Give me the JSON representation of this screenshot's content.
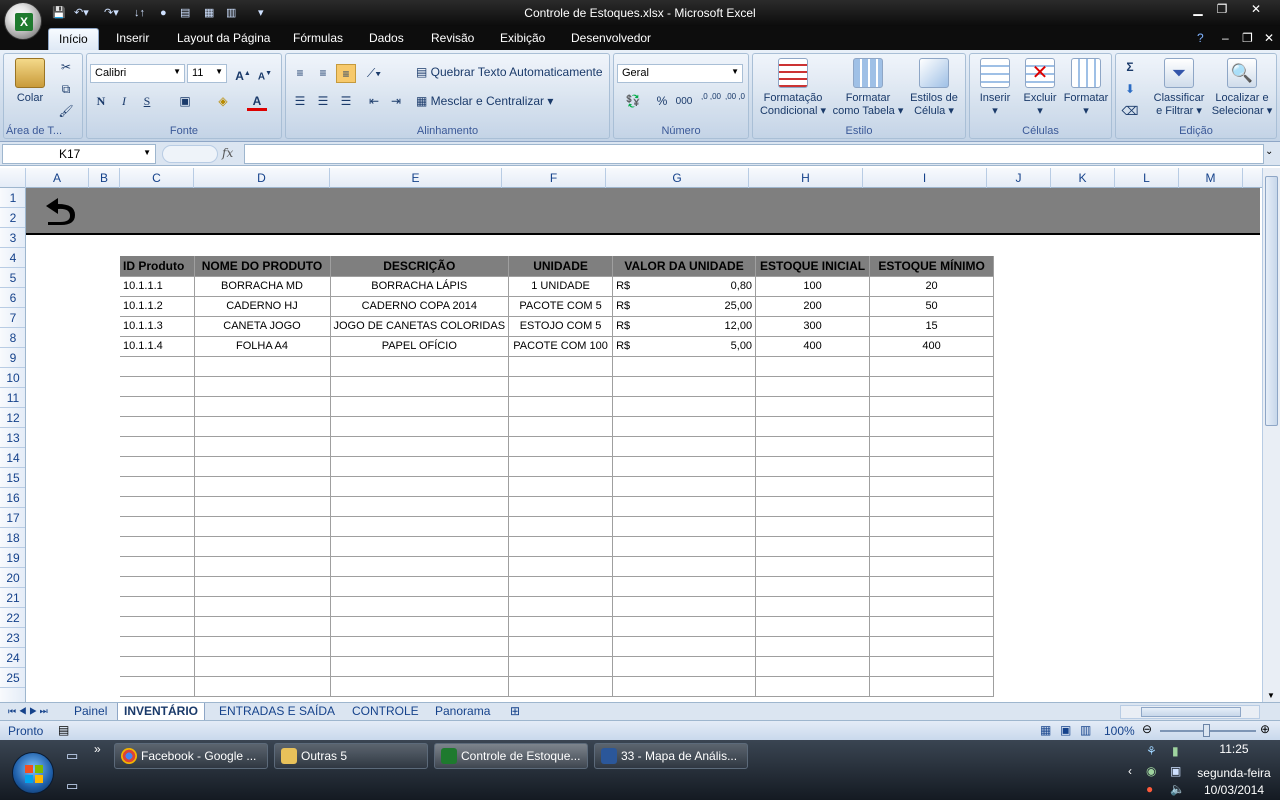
{
  "window": {
    "title": "Controle de Estoques.xlsx - Microsoft Excel"
  },
  "ribbon": {
    "tabs": [
      "Início",
      "Inserir",
      "Layout da Página",
      "Fórmulas",
      "Dados",
      "Revisão",
      "Exibição",
      "Desenvolvedor"
    ],
    "active_tab": "Início",
    "groups": {
      "clipboard": {
        "label": "Área de T...",
        "paste": "Colar"
      },
      "font": {
        "label": "Fonte",
        "font_name": "Calibri",
        "font_size": "11",
        "bold": "N",
        "italic": "I",
        "underline": "S"
      },
      "alignment": {
        "label": "Alinhamento",
        "wrap_text": "Quebrar Texto Automaticamente",
        "merge_center": "Mesclar e Centralizar"
      },
      "number": {
        "label": "Número",
        "format": "Geral",
        "percent": "%",
        "thousands": "000",
        "inc_decimal": ",0 ,00",
        "dec_decimal": ",00 ,0"
      },
      "style": {
        "label": "Estilo",
        "conditional": [
          "Formatação",
          "Condicional"
        ],
        "as_table": [
          "Formatar",
          "como Tabela"
        ],
        "cell_styles": [
          "Estilos de",
          "Célula"
        ]
      },
      "cells": {
        "label": "Células",
        "insert": "Inserir",
        "delete": "Excluir",
        "format": "Formatar"
      },
      "editing": {
        "label": "Edição",
        "sort_filter": [
          "Classificar",
          "e Filtrar"
        ],
        "find_select": [
          "Localizar e",
          "Selecionar"
        ],
        "sum": "Σ"
      }
    }
  },
  "formula_bar": {
    "name_box": "K17",
    "fx": "fx",
    "content": ""
  },
  "columns": [
    "A",
    "B",
    "C",
    "D",
    "E",
    "F",
    "G",
    "H",
    "I",
    "J",
    "K",
    "L",
    "M"
  ],
  "rows": [
    "1",
    "2",
    "3",
    "4",
    "5",
    "6",
    "7",
    "8",
    "9",
    "10",
    "11",
    "12",
    "13",
    "14",
    "15",
    "16",
    "17",
    "18",
    "19",
    "20",
    "21",
    "22",
    "23",
    "24",
    "25"
  ],
  "table": {
    "headers": [
      "ID Produto",
      "NOME DO PRODUTO",
      "DESCRIÇÃO",
      "UNIDADE",
      "VALOR DA UNIDADE",
      "ESTOQUE INICIAL",
      "ESTOQUE MÍNIMO"
    ],
    "rows": [
      {
        "id": "10.1.1.1",
        "nome": "BORRACHA MD",
        "descricao": "BORRACHA LÁPIS",
        "unidade": "1 UNIDADE",
        "moeda": "R$",
        "valor": "0,80",
        "inicial": "100",
        "minimo": "20"
      },
      {
        "id": "10.1.1.2",
        "nome": "CADERNO HJ",
        "descricao": "CADERNO COPA 2014",
        "unidade": "PACOTE COM 5",
        "moeda": "R$",
        "valor": "25,00",
        "inicial": "200",
        "minimo": "50"
      },
      {
        "id": "10.1.1.3",
        "nome": "CANETA JOGO",
        "descricao": "JOGO DE CANETAS COLORIDAS",
        "unidade": "ESTOJO COM 5",
        "moeda": "R$",
        "valor": "12,00",
        "inicial": "300",
        "minimo": "15"
      },
      {
        "id": "10.1.1.4",
        "nome": "FOLHA A4",
        "descricao": "PAPEL OFÍCIO",
        "unidade": "PACOTE COM 100",
        "moeda": "R$",
        "valor": "5,00",
        "inicial": "400",
        "minimo": "400"
      }
    ]
  },
  "sheet_tabs": [
    "Painel",
    "INVENTÁRIO",
    "ENTRADAS E SAÍDA",
    "CONTROLE",
    "Panorama"
  ],
  "active_sheet": "INVENTÁRIO",
  "status": {
    "ready": "Pronto",
    "zoom": "100%"
  },
  "taskbar": {
    "items": [
      "Facebook - Google ...",
      "Outras 5",
      "Controle de Estoque...",
      "33 - Mapa de Anális..."
    ],
    "time": "11:25",
    "day": "segunda-feira",
    "date": "10/03/2014"
  }
}
